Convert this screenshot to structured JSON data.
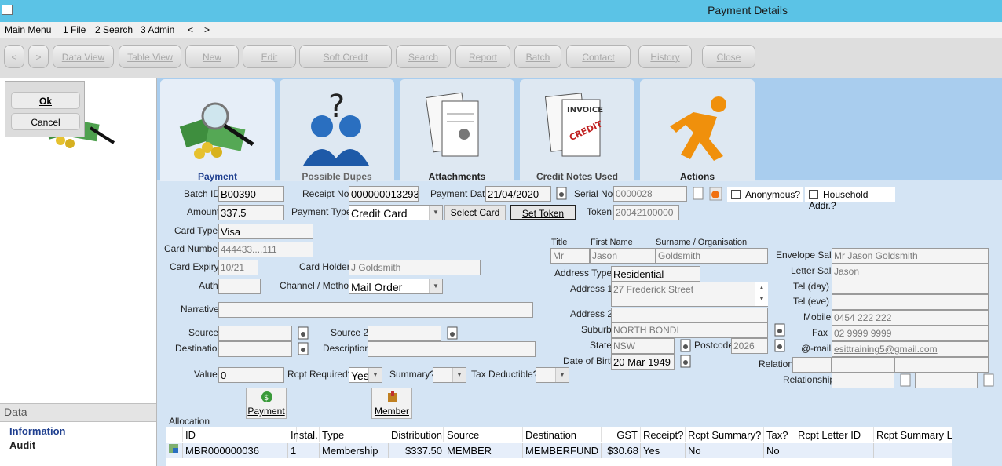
{
  "window": {
    "title": "Payment Details"
  },
  "menu": [
    "Main Menu",
    "1 File",
    "2 Search",
    "3 Admin",
    "<",
    ">"
  ],
  "toolbar": {
    "back": "<",
    "forward": ">",
    "buttons": [
      "Data View",
      "Table View",
      "New",
      "Edit",
      "Soft Credit",
      "Search",
      "Report",
      "Batch",
      "Contact",
      "History",
      "Close"
    ]
  },
  "dialog": {
    "ok": "Ok",
    "cancel": "Cancel"
  },
  "left_panel": {
    "heading": "Data",
    "items": [
      "Information",
      "Audit"
    ]
  },
  "tabs": [
    "Payment",
    "Possible Dupes",
    "Attachments",
    "Credit Notes Used",
    "Actions"
  ],
  "payment": {
    "batch_id_label": "Batch ID",
    "batch_id": "B00390",
    "receipt_no_label": "Receipt No.",
    "receipt_no": "000000013293",
    "payment_date_label": "Payment Date",
    "payment_date": "21/04/2020",
    "serial_no_label": "Serial No.",
    "serial_no": "0000028",
    "anonymous_label": "Anonymous?",
    "household_label": "Household Addr.?",
    "amount_label": "Amount",
    "amount": "337.5",
    "payment_type_label": "Payment Type",
    "payment_type": "Credit Card",
    "select_card": "Select Card",
    "set_token": "Set Token",
    "token_label": "Token",
    "token": "20042100000",
    "card_type_label": "Card Type",
    "card_type": "Visa",
    "card_number_label": "Card Number",
    "card_number": "444433....111",
    "card_expiry_label": "Card Expiry",
    "card_expiry": "10/21",
    "card_holder_label": "Card Holder",
    "card_holder": "J Goldsmith",
    "auth_label": "Auth",
    "auth": "",
    "channel_label": "Channel / Method",
    "channel": "Mail Order",
    "narrative_label": "Narrative",
    "narrative": "",
    "source_label": "Source",
    "source": "",
    "source2_label": "Source 2",
    "source2": "",
    "destination_label": "Destination",
    "destination": "",
    "description_label": "Description",
    "description": "",
    "value_label": "Value",
    "value": "0",
    "rcpt_required_label": "Rcpt Required?",
    "rcpt_required": "Yes",
    "summary_label": "Summary?",
    "summary": "",
    "tax_deductible_label": "Tax Deductible?",
    "tax_deductible": "",
    "payment_button": "Payment",
    "member_button": "Member"
  },
  "contact": {
    "title_label": "Title",
    "title": "Mr",
    "first_name_label": "First Name",
    "first_name": "Jason",
    "surname_label": "Surname / Organisation",
    "surname": "Goldsmith",
    "envelope_sal_label": "Envelope Sal.",
    "envelope_sal": "Mr Jason Goldsmith",
    "letter_sal_label": "Letter Sal.",
    "letter_sal": "Jason",
    "address_type_label": "Address Type",
    "address_type": "Residential",
    "address1_label": "Address 1",
    "address1": "27 Frederick Street",
    "address2_label": "Address 2",
    "address2": "",
    "suburb_label": "Suburb",
    "suburb": "NORTH BONDI",
    "state_label": "State",
    "state": "NSW",
    "postcode_label": "Postcode",
    "postcode": "2026",
    "dob_label": "Date of Birth",
    "dob": "20 Mar 1949",
    "tel_day_label": "Tel (day)",
    "tel_day": "",
    "tel_eve_label": "Tel (eve)",
    "tel_eve": "",
    "mobile_label": "Mobile",
    "mobile": "0454 222 222",
    "fax_label": "Fax",
    "fax": "02 9999 9999",
    "email_label": "@-mail",
    "email": "esittraining5@gmail.com",
    "relation_label": "Relation",
    "relationship_label": "Relationship"
  },
  "allocation": {
    "label": "Allocation",
    "columns": [
      "ID",
      "Instal.",
      "Type",
      "Distribution",
      "Source",
      "Destination",
      "GST",
      "Receipt?",
      "Rcpt Summary?",
      "Tax?",
      "Rcpt Letter ID",
      "Rcpt Summary L"
    ],
    "rows": [
      [
        "MBR000000036",
        "1",
        "Membership",
        "$337.50",
        "MEMBER",
        "MEMBERFUND",
        "$30.68",
        "Yes",
        "No",
        "No",
        "",
        ""
      ]
    ]
  },
  "colors": {
    "titlebar": "#5bc3e6",
    "tabstrip": "#a9cdee",
    "panel": "#d4e4f4",
    "tab": "#dee8f2",
    "link": "#1f3f8f"
  }
}
